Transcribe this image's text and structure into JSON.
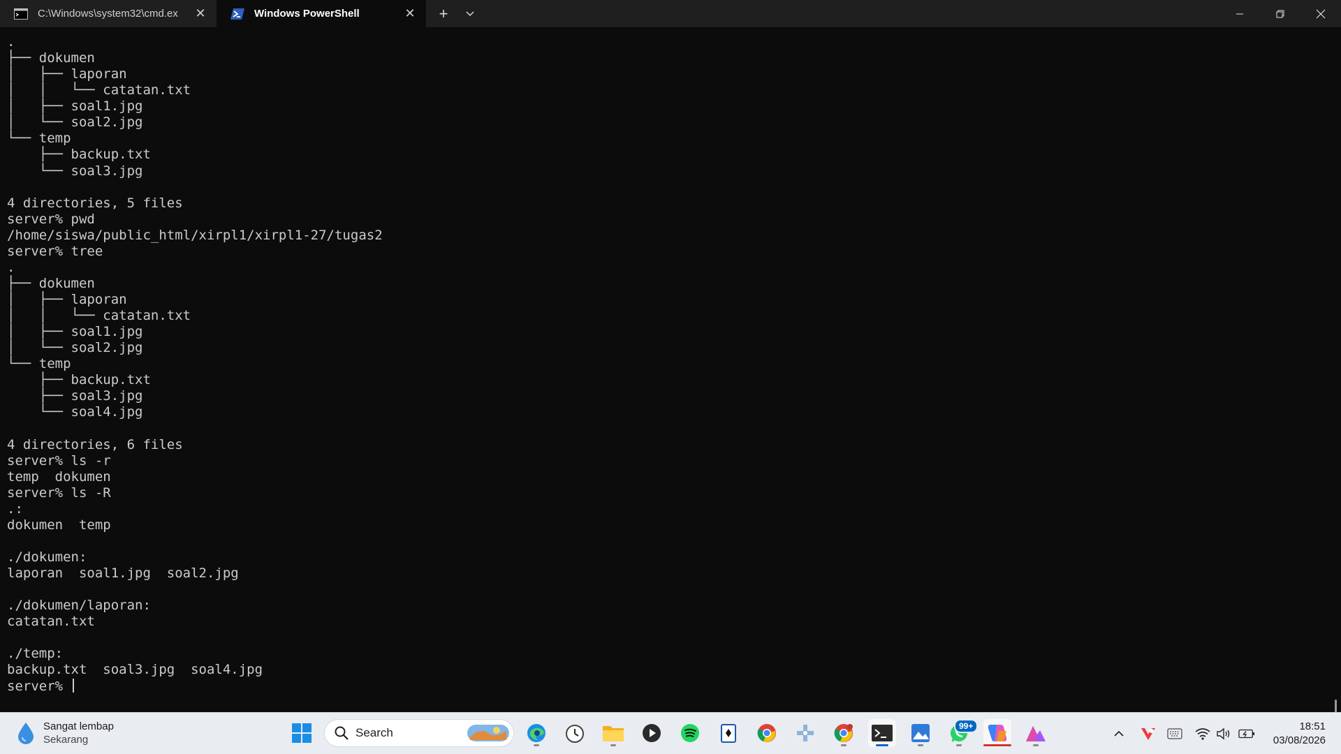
{
  "tabs": [
    {
      "title": "C:\\Windows\\system32\\cmd.ex",
      "icon": "cmd-icon",
      "close": "✕"
    },
    {
      "title": "Windows PowerShell",
      "icon": "powershell-icon",
      "close": "✕"
    }
  ],
  "tab_actions": {
    "new_tab": "+",
    "dropdown": "⌄"
  },
  "terminal": {
    "lines": [
      ".",
      "├── dokumen",
      "│   ├── laporan",
      "│   │   └── catatan.txt",
      "│   ├── soal1.jpg",
      "│   └── soal2.jpg",
      "└── temp",
      "    ├── backup.txt",
      "    └── soal3.jpg",
      "",
      "4 directories, 5 files",
      "server% pwd",
      "/home/siswa/public_html/xirpl1/xirpl1-27/tugas2",
      "server% tree",
      ".",
      "├── dokumen",
      "│   ├── laporan",
      "│   │   └── catatan.txt",
      "│   ├── soal1.jpg",
      "│   └── soal2.jpg",
      "└── temp",
      "    ├── backup.txt",
      "    ├── soal3.jpg",
      "    └── soal4.jpg",
      "",
      "4 directories, 6 files",
      "server% ls -r",
      "temp  dokumen",
      "server% ls -R",
      ".:",
      "dokumen  temp",
      "",
      "./dokumen:",
      "laporan  soal1.jpg  soal2.jpg",
      "",
      "./dokumen/laporan:",
      "catatan.txt",
      "",
      "./temp:",
      "backup.txt  soal3.jpg  soal4.jpg"
    ],
    "prompt": "server% "
  },
  "taskbar": {
    "weather": {
      "title": "Sangat lembap",
      "subtitle": "Sekarang"
    },
    "search_placeholder": "Search",
    "apps": [
      "start-icon",
      "edge-icon",
      "clock-app-icon",
      "file-explorer-icon",
      "media-player-icon",
      "spotify-icon",
      "solitaire-icon",
      "chrome-icon",
      "gamepad-icon",
      "chrome-profile-icon",
      "terminal-icon",
      "photos-icon",
      "whatsapp-icon",
      "copilot-icon",
      "creative-app-icon"
    ],
    "whatsapp_badge": "99+",
    "tray": {
      "chevron": "^"
    },
    "clock": {
      "time": "18:51",
      "date": "03/08/2026"
    }
  },
  "colors": {
    "terminal_bg": "#0c0c0c",
    "terminal_fg": "#cccccc",
    "titlebar_bg": "#1f1f1f",
    "taskbar_bg": "#e9ecf1",
    "accent": "#0067c0"
  }
}
